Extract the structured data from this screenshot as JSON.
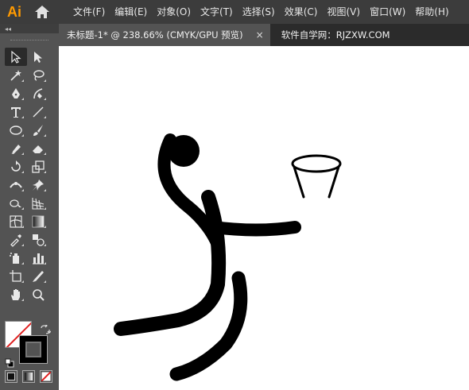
{
  "app": {
    "logo": "Ai"
  },
  "menu": [
    "文件(F)",
    "编辑(E)",
    "对象(O)",
    "文字(T)",
    "选择(S)",
    "效果(C)",
    "视图(V)",
    "窗口(W)",
    "帮助(H)"
  ],
  "tabs": {
    "document": "未标题-1* @ 238.66% (CMYK/GPU 预览)",
    "close": "×",
    "site": "软件自学网：RJZXW.COM"
  },
  "toolbar": {
    "collapse": "◂◂"
  },
  "colors": {
    "fill": "#ffffff",
    "stroke": "#000000",
    "accent": "#ff9a00"
  }
}
